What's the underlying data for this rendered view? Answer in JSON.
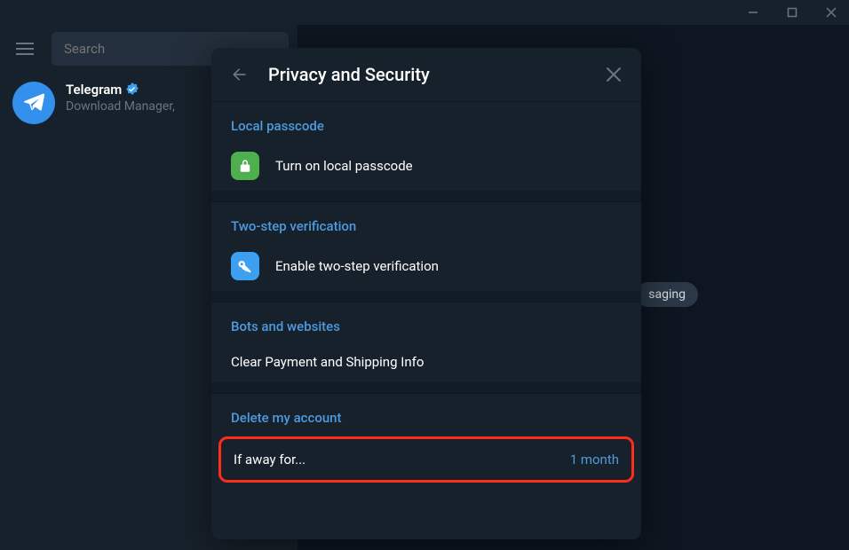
{
  "titlebar": {
    "minimize": "−",
    "maximize": "□",
    "close": "✕"
  },
  "sidebar": {
    "search_placeholder": "Search",
    "chat": {
      "name": "Telegram",
      "preview": "Download Manager,"
    }
  },
  "main": {
    "badge_text": "saging"
  },
  "modal": {
    "title": "Privacy and Security",
    "sections": {
      "local_passcode": {
        "header": "Local passcode",
        "item": "Turn on local passcode"
      },
      "two_step": {
        "header": "Two-step verification",
        "item": "Enable two-step verification"
      },
      "bots": {
        "header": "Bots and websites",
        "item": "Clear Payment and Shipping Info"
      },
      "delete_account": {
        "header": "Delete my account",
        "item_label": "If away for...",
        "item_value": "1 month"
      }
    }
  }
}
